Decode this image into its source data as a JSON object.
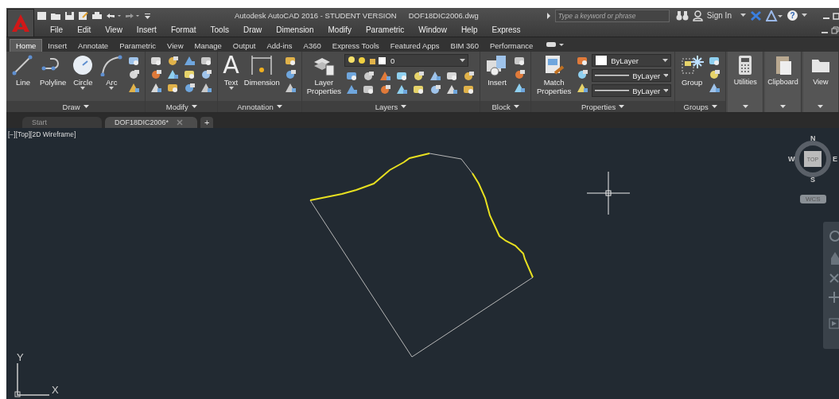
{
  "title_bar": {
    "app_title": "Autodesk AutoCAD 2016 - STUDENT VERSION",
    "file_name": "DOF18DIC2006.dwg",
    "search": {
      "placeholder": "Type a keyword or phrase"
    },
    "sign_in": "Sign In",
    "help": "?"
  },
  "menu_bar": [
    "File",
    "Edit",
    "View",
    "Insert",
    "Format",
    "Tools",
    "Draw",
    "Dimension",
    "Modify",
    "Parametric",
    "Window",
    "Help",
    "Express"
  ],
  "ribbon_tabs": [
    {
      "label": "Home",
      "selected": true
    },
    {
      "label": "Insert",
      "selected": false
    },
    {
      "label": "Annotate",
      "selected": false
    },
    {
      "label": "Parametric",
      "selected": false
    },
    {
      "label": "View",
      "selected": false
    },
    {
      "label": "Manage",
      "selected": false
    },
    {
      "label": "Output",
      "selected": false
    },
    {
      "label": "Add-ins",
      "selected": false
    },
    {
      "label": "A360",
      "selected": false
    },
    {
      "label": "Express Tools",
      "selected": false
    },
    {
      "label": "Featured Apps",
      "selected": false
    },
    {
      "label": "BIM 360",
      "selected": false
    },
    {
      "label": "Performance",
      "selected": false
    }
  ],
  "ribbon_panels": [
    {
      "label": "Draw",
      "tools": [
        {
          "label": "Line",
          "dropdown": false
        },
        {
          "label": "Polyline",
          "dropdown": false
        },
        {
          "label": "Circle",
          "dropdown": true
        },
        {
          "label": "Arc",
          "dropdown": true
        }
      ]
    },
    {
      "label": "Modify"
    },
    {
      "label": "Annotation",
      "tools": [
        {
          "label": "Text",
          "glyph": "A",
          "dropdown": true
        },
        {
          "label": "Dimension",
          "dropdown": false
        }
      ]
    },
    {
      "label": "Layers",
      "tools": [
        {
          "label": "Layer Properties",
          "dropdown": false
        }
      ],
      "dropdowns": [
        {
          "kind": "layer",
          "value": "0"
        }
      ]
    },
    {
      "label": "Block",
      "tools": [
        {
          "label": "Insert",
          "dropdown": false
        }
      ]
    },
    {
      "label": "Properties",
      "tools": [
        {
          "label": "Match Properties",
          "dropdown": false
        }
      ],
      "dropdowns": [
        {
          "kind": "color",
          "value": "ByLayer"
        },
        {
          "kind": "line",
          "value": "ByLayer"
        },
        {
          "kind": "line",
          "value": "ByLayer"
        }
      ]
    },
    {
      "label": "Groups",
      "tools": [
        {
          "label": "Group",
          "dropdown": false
        }
      ]
    },
    {
      "tools": [
        {
          "label": "Utilities",
          "dropdown": false
        }
      ]
    },
    {
      "tools": [
        {
          "label": "Clipboard",
          "dropdown": false
        }
      ]
    },
    {
      "tools": [
        {
          "label": "View",
          "dropdown": false
        }
      ]
    }
  ],
  "document_tabs": [
    {
      "label": "Start",
      "selected": false
    },
    {
      "label": "DOF18DIC2006*",
      "selected": true
    }
  ],
  "new_tab": "+",
  "viewport": {
    "controls": "[−][Top][2D Wireframe]",
    "viewcube": {
      "top": "TOP",
      "north": "N",
      "south": "S",
      "east": "E",
      "west": "W"
    },
    "coordinate_system": "WCS",
    "ucs": {
      "x": "X",
      "y": "Y"
    }
  }
}
